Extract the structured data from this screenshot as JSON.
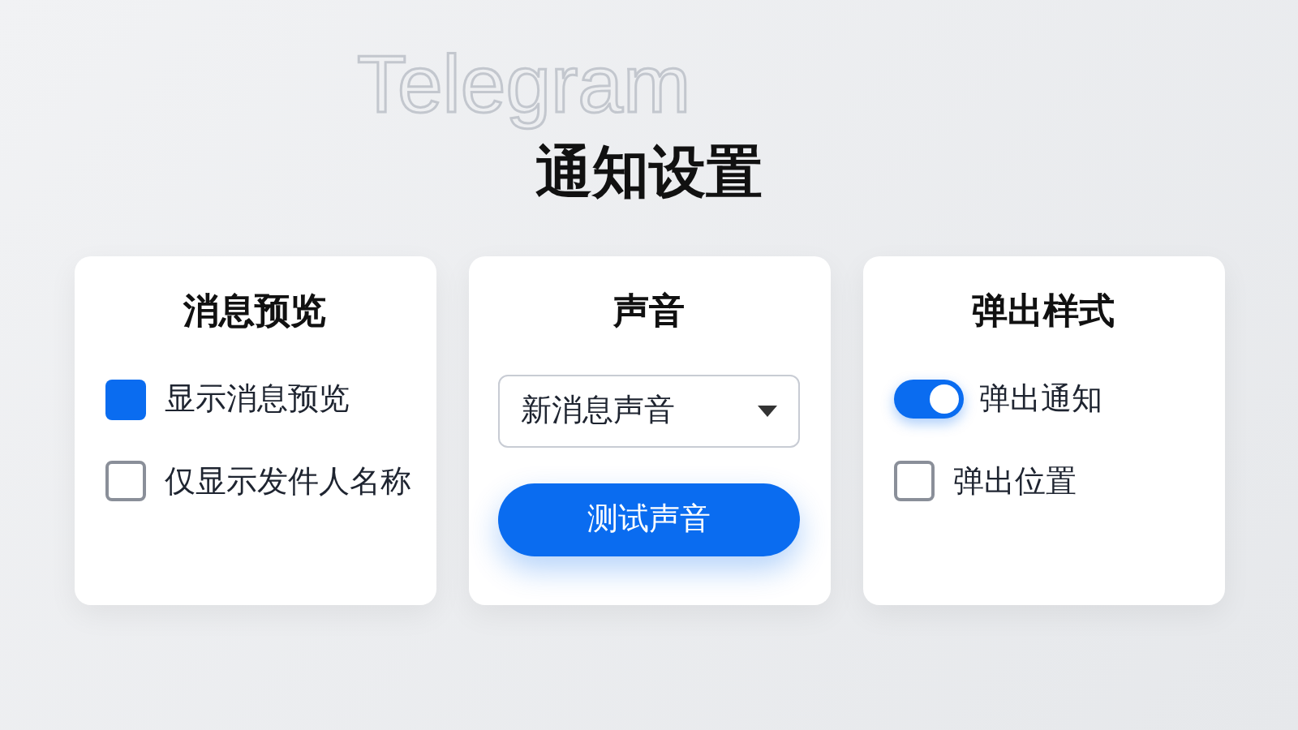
{
  "background_text": "Telegram",
  "title": "通知设置",
  "cards": [
    {
      "title": "消息预览",
      "items": [
        {
          "kind": "checkbox",
          "label": "显示消息预览",
          "checked": true
        },
        {
          "kind": "checkbox",
          "label": "仅显示发件人名称",
          "checked": false
        }
      ]
    },
    {
      "title": "声音",
      "items": [
        {
          "kind": "select",
          "value": "新消息声音"
        },
        {
          "kind": "button",
          "label": "测试声音"
        }
      ]
    },
    {
      "title": "弹出样式",
      "items": [
        {
          "kind": "toggle",
          "label": "弹出通知",
          "on": true
        },
        {
          "kind": "checkbox",
          "label": "弹出位置",
          "checked": false
        }
      ]
    }
  ]
}
